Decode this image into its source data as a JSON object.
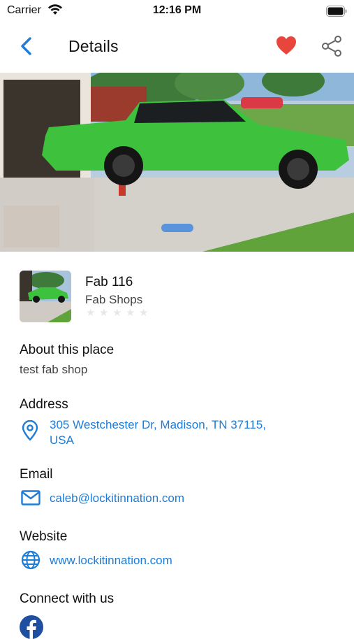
{
  "status_bar": {
    "carrier": "Carrier",
    "time": "12:16 PM"
  },
  "header": {
    "title": "Details"
  },
  "place": {
    "name": "Fab 116",
    "category": "Fab Shops",
    "rating": 0
  },
  "about": {
    "title": "About this place",
    "text": "test fab shop"
  },
  "address": {
    "title": "Address",
    "line1": "305 Westchester Dr, Madison, TN 37115,",
    "line2": "USA"
  },
  "email": {
    "title": "Email",
    "value": "caleb@lockitinnation.com"
  },
  "website": {
    "title": "Website",
    "value": "www.lockitinnation.com"
  },
  "connect": {
    "title": "Connect with us"
  },
  "colors": {
    "accent": "#1e7cd6",
    "heart": "#e8463c",
    "car": "#3ec23e"
  },
  "icons": [
    "back-chevron-icon",
    "heart-icon",
    "share-icon",
    "location-pin-icon",
    "mail-icon",
    "globe-icon",
    "facebook-icon"
  ]
}
